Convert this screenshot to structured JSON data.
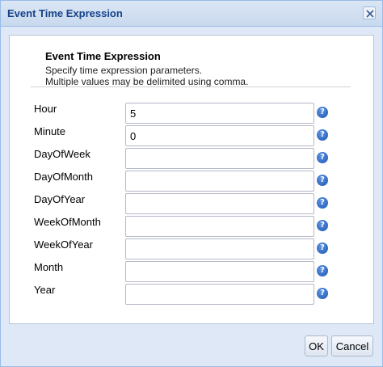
{
  "dialog": {
    "title": "Event Time Expression",
    "close_icon": "close-icon"
  },
  "header": {
    "title": "Event Time Expression",
    "line1": "Specify time expression parameters.",
    "line2": "Multiple values may be delimited using comma."
  },
  "fields": [
    {
      "label": "Hour",
      "value": "5"
    },
    {
      "label": "Minute",
      "value": "0"
    },
    {
      "label": "DayOfWeek",
      "value": ""
    },
    {
      "label": "DayOfMonth",
      "value": ""
    },
    {
      "label": "DayOfYear",
      "value": ""
    },
    {
      "label": "WeekOfMonth",
      "value": ""
    },
    {
      "label": "WeekOfYear",
      "value": ""
    },
    {
      "label": "Month",
      "value": ""
    },
    {
      "label": "Year",
      "value": ""
    }
  ],
  "help_icon": "help-icon",
  "help_glyph": "?",
  "buttons": {
    "ok": "OK",
    "cancel": "Cancel"
  }
}
